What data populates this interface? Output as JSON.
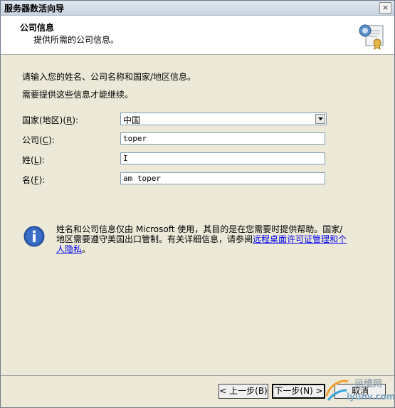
{
  "window": {
    "title": "服务器数活向导",
    "close_glyph": "×"
  },
  "header": {
    "title": "公司信息",
    "subtitle": "提供所需的公司信息。",
    "icon": "certificate-icon"
  },
  "intro": {
    "line1": "请输入您的姓名、公司名称和国家/地区信息。",
    "line2": "需要提供这些信息才能继续。"
  },
  "fields": {
    "country": {
      "label": "国家(地区)",
      "hotkey": "R",
      "suffix": "):",
      "value": "中国"
    },
    "company": {
      "label": "公司(",
      "hotkey": "C",
      "suffix": "):",
      "value": "toper"
    },
    "surname": {
      "label": "姓(",
      "hotkey": "L",
      "suffix": "):",
      "value": "I"
    },
    "given": {
      "label": "名(",
      "hotkey": "F",
      "suffix": "):",
      "value": "am toper"
    }
  },
  "notice": {
    "icon": "info-icon",
    "text": "姓名和公司信息仅由 Microsoft 使用，其目的是在您需要时提供帮助。国家/地区需要遵守美国出口管制。有关详细信息，请参阅",
    "link": "远程桌面许可证管理和个人隐私",
    "end": "。"
  },
  "buttons": {
    "back": "< 上一步(B)",
    "next": "下一步(N) >",
    "cancel": "取消"
  },
  "watermark": {
    "line1": "运维网",
    "line2": "iyunv.com"
  }
}
